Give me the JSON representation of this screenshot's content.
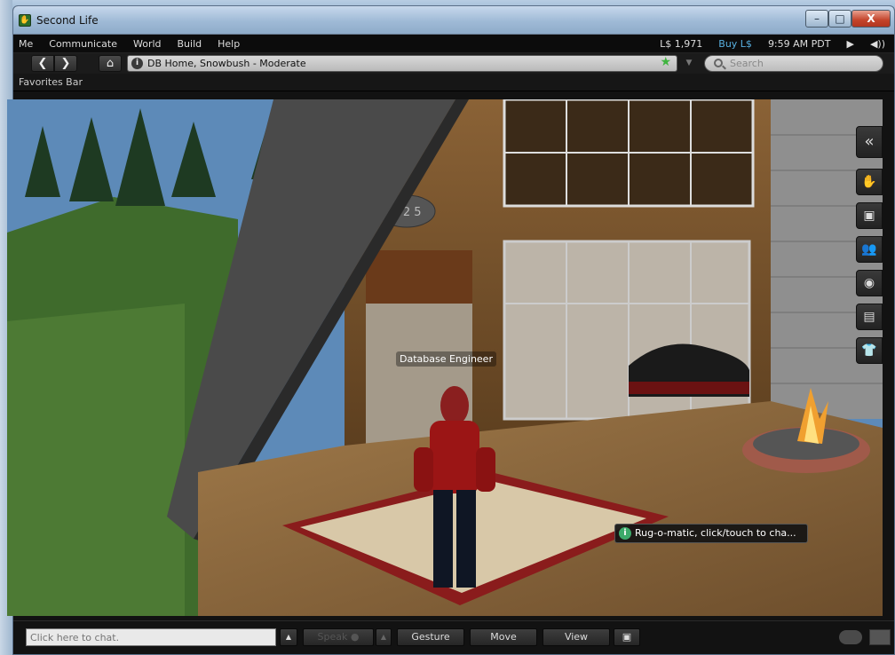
{
  "window": {
    "title": "Second Life",
    "minimize": "–",
    "maximize": "□",
    "close": "X"
  },
  "menubar": {
    "items": [
      "Me",
      "Communicate",
      "World",
      "Build",
      "Help"
    ],
    "balance": "L$ 1,971",
    "buy": "Buy L$",
    "time": "9:59 AM PDT",
    "play_icon": "▶",
    "volume_icon": "◀))"
  },
  "navbar": {
    "back": "❮",
    "forward": "❯",
    "home": "⌂",
    "location": "DB Home, Snowbush - Moderate",
    "search_placeholder": "Search"
  },
  "favorites": {
    "label": "Favorites Bar"
  },
  "scene": {
    "avatar_name": "Database Engineer",
    "tooltip": "Rug-o-matic, click/touch to cha..."
  },
  "sidebar": {
    "collapse": "«",
    "tabs": [
      {
        "icon": "hand-icon",
        "glyph": "✋"
      },
      {
        "icon": "profile-icon",
        "glyph": "▣"
      },
      {
        "icon": "people-icon",
        "glyph": "👥"
      },
      {
        "icon": "places-icon",
        "glyph": "◉"
      },
      {
        "icon": "inventory-icon",
        "glyph": "▤"
      },
      {
        "icon": "appearance-icon",
        "glyph": "👕"
      }
    ]
  },
  "bottombar": {
    "chat_placeholder": "Click here to chat.",
    "speak": "Speak ●",
    "gesture": "Gesture",
    "move": "Move",
    "view": "View"
  },
  "colors": {
    "accent_link": "#58b0e0",
    "favorite_star": "#3fb43f",
    "tooltip_info": "#3caa6a"
  }
}
